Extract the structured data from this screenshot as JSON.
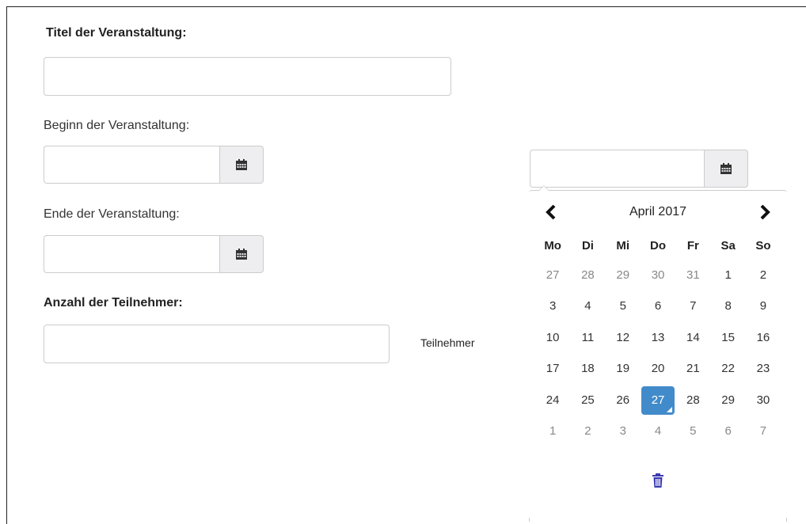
{
  "form": {
    "title_label": "Titel der Veranstaltung:",
    "title_value": "",
    "start_label": "Beginn der Veranstaltung:",
    "start_value": "",
    "end_label": "Ende der Veranstaltung:",
    "end_value": "",
    "participants_label": "Anzahl der Teilnehmer:",
    "participants_value": "",
    "participants_suffix": "Teilnehmer"
  },
  "picker_input_value": "",
  "datepicker": {
    "month_title": "April 2017",
    "weekdays": [
      "Mo",
      "Di",
      "Mi",
      "Do",
      "Fr",
      "Sa",
      "So"
    ],
    "weeks": [
      [
        "27",
        "28",
        "29",
        "30",
        "31",
        "1",
        "2"
      ],
      [
        "3",
        "4",
        "5",
        "6",
        "7",
        "8",
        "9"
      ],
      [
        "10",
        "11",
        "12",
        "13",
        "14",
        "15",
        "16"
      ],
      [
        "17",
        "18",
        "19",
        "20",
        "21",
        "22",
        "23"
      ],
      [
        "24",
        "25",
        "26",
        "27",
        "28",
        "29",
        "30"
      ],
      [
        "1",
        "2",
        "3",
        "4",
        "5",
        "6",
        "7"
      ]
    ],
    "selected_day": "27"
  },
  "icons": {
    "calendar": "calendar-icon",
    "prev": "chevron-left-icon",
    "next": "chevron-right-icon",
    "clear": "trash-icon"
  },
  "colors": {
    "selected": "#428bca",
    "addon_bg": "#eeeef0",
    "trash": "#3a3ab0"
  }
}
